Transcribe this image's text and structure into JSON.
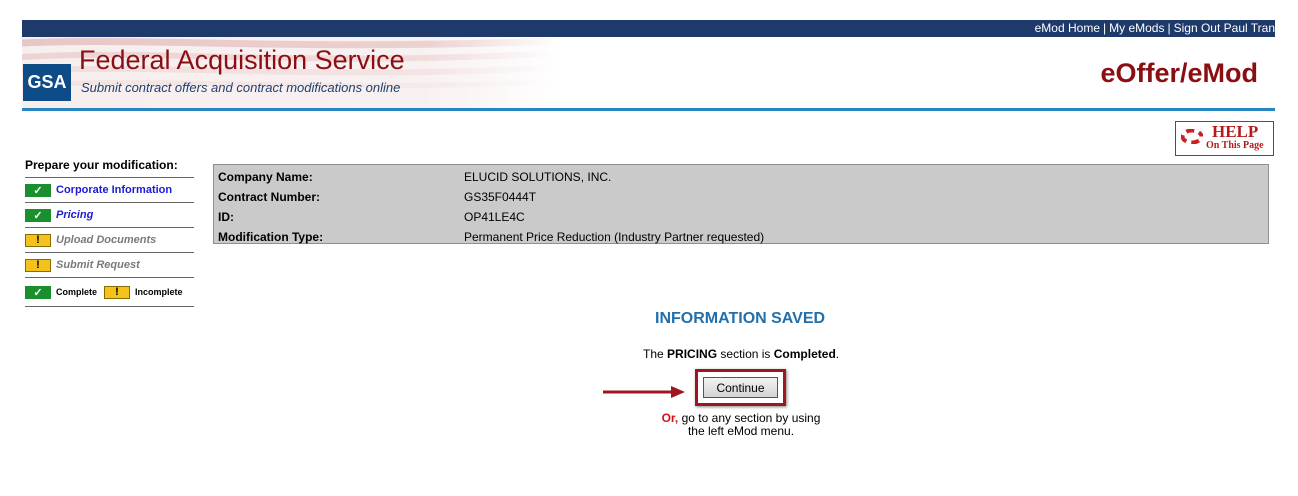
{
  "topnav": {
    "links": [
      "eMod Home",
      "My eMods",
      "Sign Out Paul Tran"
    ],
    "separator": "|"
  },
  "header": {
    "logo_text": "GSA",
    "title": "Federal Acquisition Service",
    "subtitle": "Submit contract offers and contract modifications online",
    "brand": "eOffer/eMod"
  },
  "help": {
    "word": "HELP",
    "sub": "On This Page"
  },
  "menu": {
    "title": "Prepare your modification:",
    "items": [
      {
        "label": "Corporate Information",
        "status": "complete",
        "icon": "check-icon"
      },
      {
        "label": "Pricing",
        "status": "complete",
        "icon": "check-icon"
      },
      {
        "label": "Upload Documents",
        "status": "incomplete",
        "icon": "exclamation-icon"
      },
      {
        "label": "Submit Request",
        "status": "incomplete",
        "icon": "exclamation-icon"
      }
    ],
    "legend": {
      "complete": "Complete",
      "incomplete": "Incomplete"
    },
    "glyphs": {
      "check": "✓",
      "warn": "!"
    }
  },
  "info": {
    "rows": [
      {
        "label": "Company Name:",
        "value": "ELUCID SOLUTIONS, INC."
      },
      {
        "label": "Contract Number:",
        "value": "GS35F0444T"
      },
      {
        "label": "ID:",
        "value": "OP41LE4C"
      },
      {
        "label": "Modification Type:",
        "value": "Permanent Price Reduction (Industry Partner requested)"
      }
    ]
  },
  "saved": {
    "title": "INFORMATION SAVED",
    "msg_prefix": "The",
    "section": "PRICING",
    "msg_mid": "section is",
    "status": "Completed",
    "msg_end": ".",
    "continue_label": "Continue",
    "or_word": "Or,",
    "or_rest": "go to any section by using",
    "or_line2": "the left eMod menu."
  },
  "colors": {
    "topbar": "#1d3a6a",
    "brand_red": "#8b0e12",
    "accent_blue": "#2586c2",
    "complete_green": "#198f2e",
    "incomplete_yellow": "#f5c21b",
    "saved_title": "#246faa",
    "highlight_red": "#a01620"
  }
}
